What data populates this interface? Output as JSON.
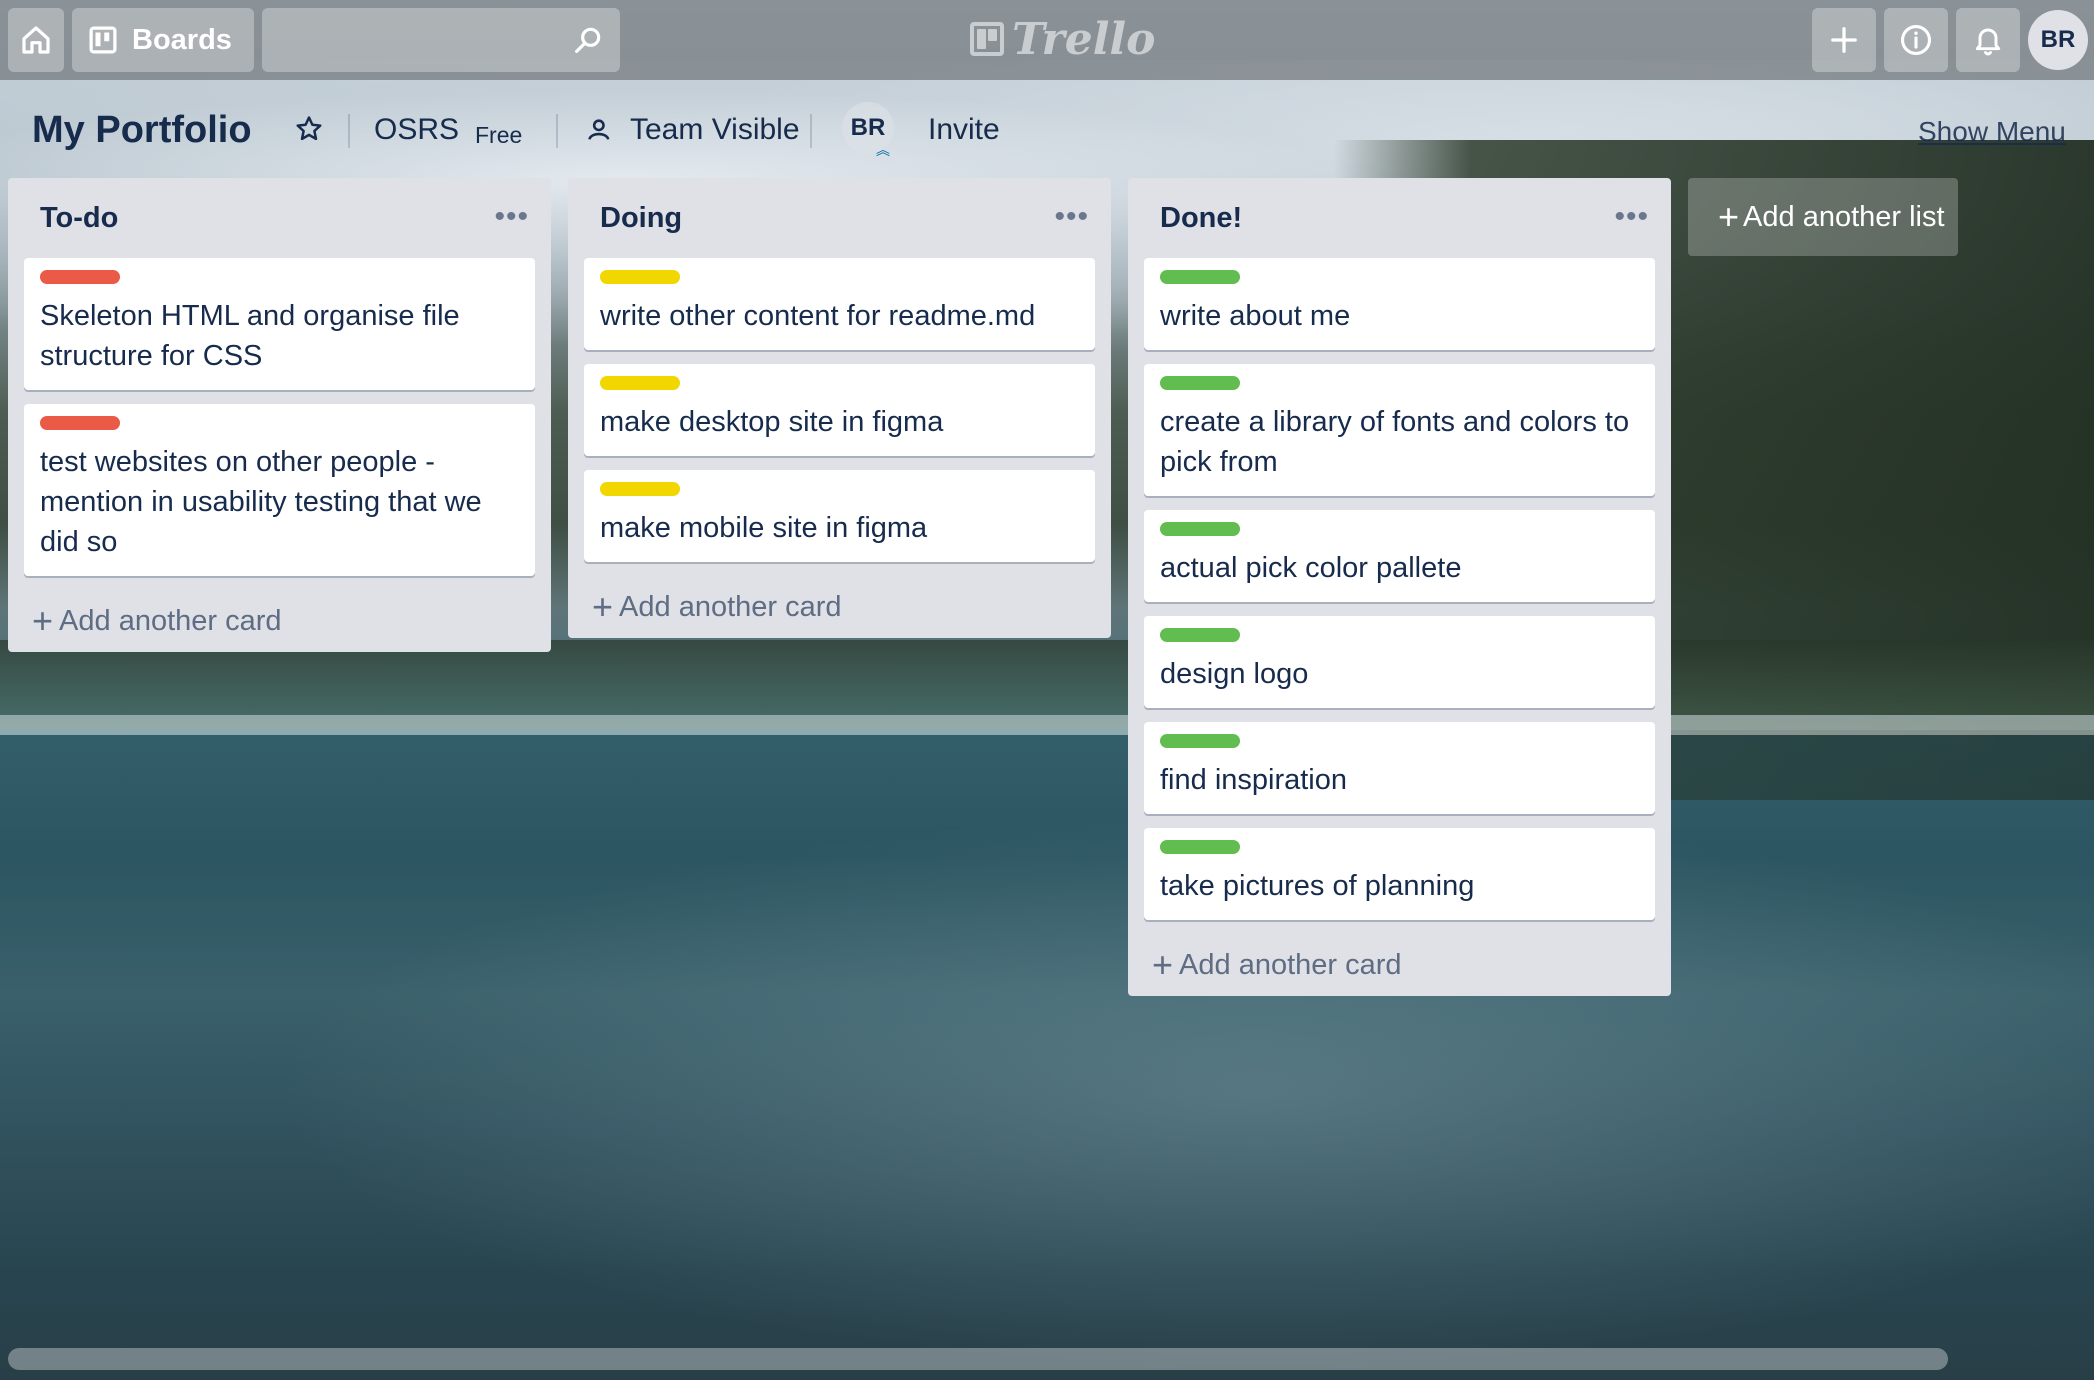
{
  "header": {
    "boards_label": "Boards",
    "search_value": "",
    "logo_text": "Trello",
    "user_initials": "BR"
  },
  "board": {
    "title": "My Portfolio",
    "team": "OSRS",
    "plan": "Free",
    "visibility": "Team Visible",
    "member_initials": "BR",
    "invite": "Invite",
    "show_menu": "Show Menu"
  },
  "lists": [
    {
      "title": "To-do",
      "add_card": "Add another card",
      "cards": [
        {
          "label_color": "#eb5a46",
          "text": "Skeleton HTML and organise file structure for CSS"
        },
        {
          "label_color": "#eb5a46",
          "text": "test websites on other people - mention in usability testing that we did so"
        }
      ]
    },
    {
      "title": "Doing",
      "add_card": "Add another card",
      "cards": [
        {
          "label_color": "#f2d600",
          "text": "write other content for readme.md"
        },
        {
          "label_color": "#f2d600",
          "text": "make desktop site in figma"
        },
        {
          "label_color": "#f2d600",
          "text": "make mobile site in figma"
        }
      ]
    },
    {
      "title": "Done!",
      "add_card": "Add another card",
      "cards": [
        {
          "label_color": "#61bd4f",
          "text": "write about me"
        },
        {
          "label_color": "#61bd4f",
          "text": "create a library of fonts and colors to pick from"
        },
        {
          "label_color": "#61bd4f",
          "text": "actual pick color pallete"
        },
        {
          "label_color": "#61bd4f",
          "text": "design logo"
        },
        {
          "label_color": "#61bd4f",
          "text": "find inspiration"
        },
        {
          "label_color": "#61bd4f",
          "text": "take pictures of planning"
        }
      ]
    }
  ],
  "add_list": "Add another list",
  "icons": {
    "home": "home-icon",
    "boards": "boards-icon",
    "search": "search-icon",
    "add": "plus-icon",
    "info": "info-icon",
    "notifications": "bell-icon",
    "star": "star-icon",
    "visibility": "team-icon",
    "list_menu": "more-icon"
  }
}
